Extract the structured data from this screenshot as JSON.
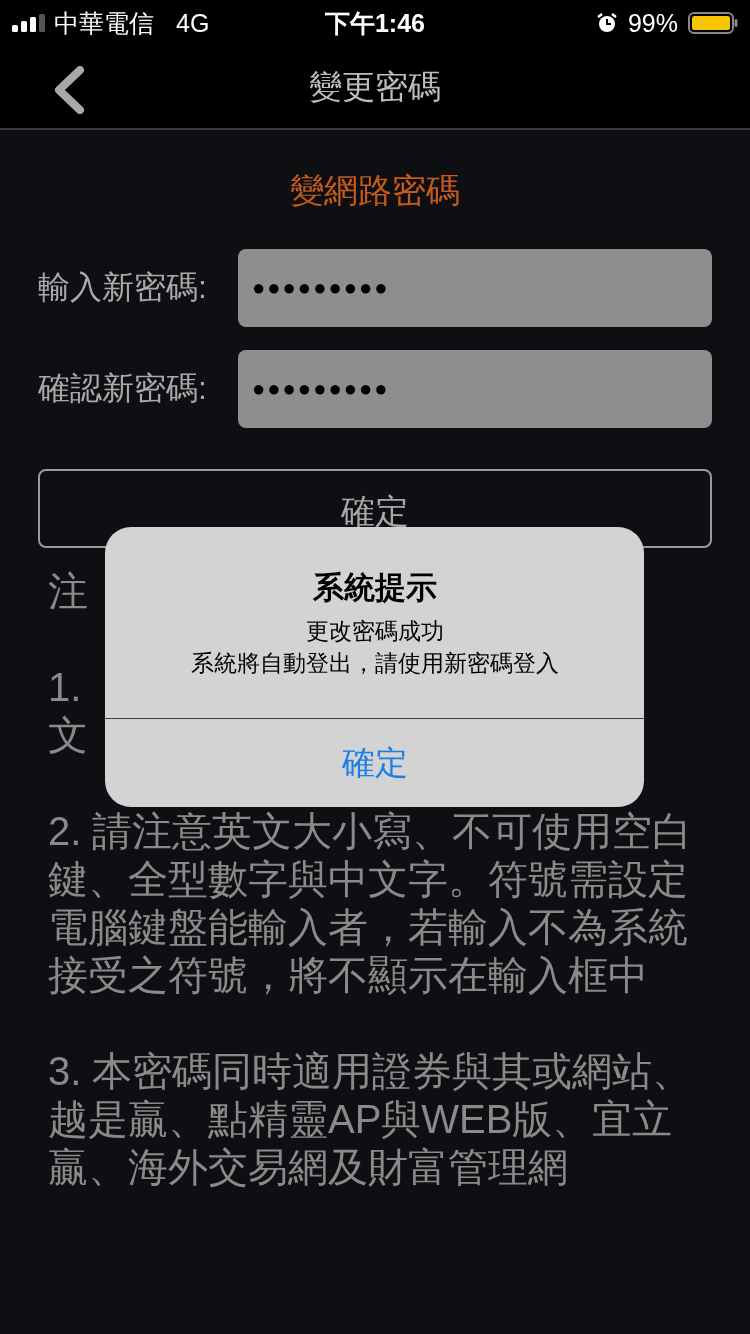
{
  "status_bar": {
    "carrier": "中華電信",
    "network": "4G",
    "time": "下午1:46",
    "battery": "99%"
  },
  "nav": {
    "title": "變更密碼"
  },
  "form": {
    "title": "變網路密碼",
    "fields": [
      {
        "label": "輸入新密碼:",
        "value": "●●●●●●●●●"
      },
      {
        "label": "確認新密碼:",
        "value": "●●●●●●●●●"
      }
    ],
    "submit": "確定"
  },
  "notes": [
    {
      "lines": [
        "注"
      ]
    },
    {
      "lines": [
        "1.",
        "文"
      ]
    },
    {
      "lines": [
        "2. 請注意英文大小寫、不可使用空白鍵、全型數字與中文字。符號需設定電腦鍵盤能輸入者，若輸入不為系統接受之符號，將不顯示在輸入框中"
      ]
    },
    {
      "lines": [
        "3. 本密碼同時適用證券與其或網站、越是贏、點精靈AP與WEB版、宜立贏、海外交易網及財富管理網"
      ]
    }
  ],
  "alert": {
    "title": "系統提示",
    "message": [
      "更改密碼成功",
      "系統將自動登出，請使用新密碼登入"
    ],
    "button": "確定"
  }
}
